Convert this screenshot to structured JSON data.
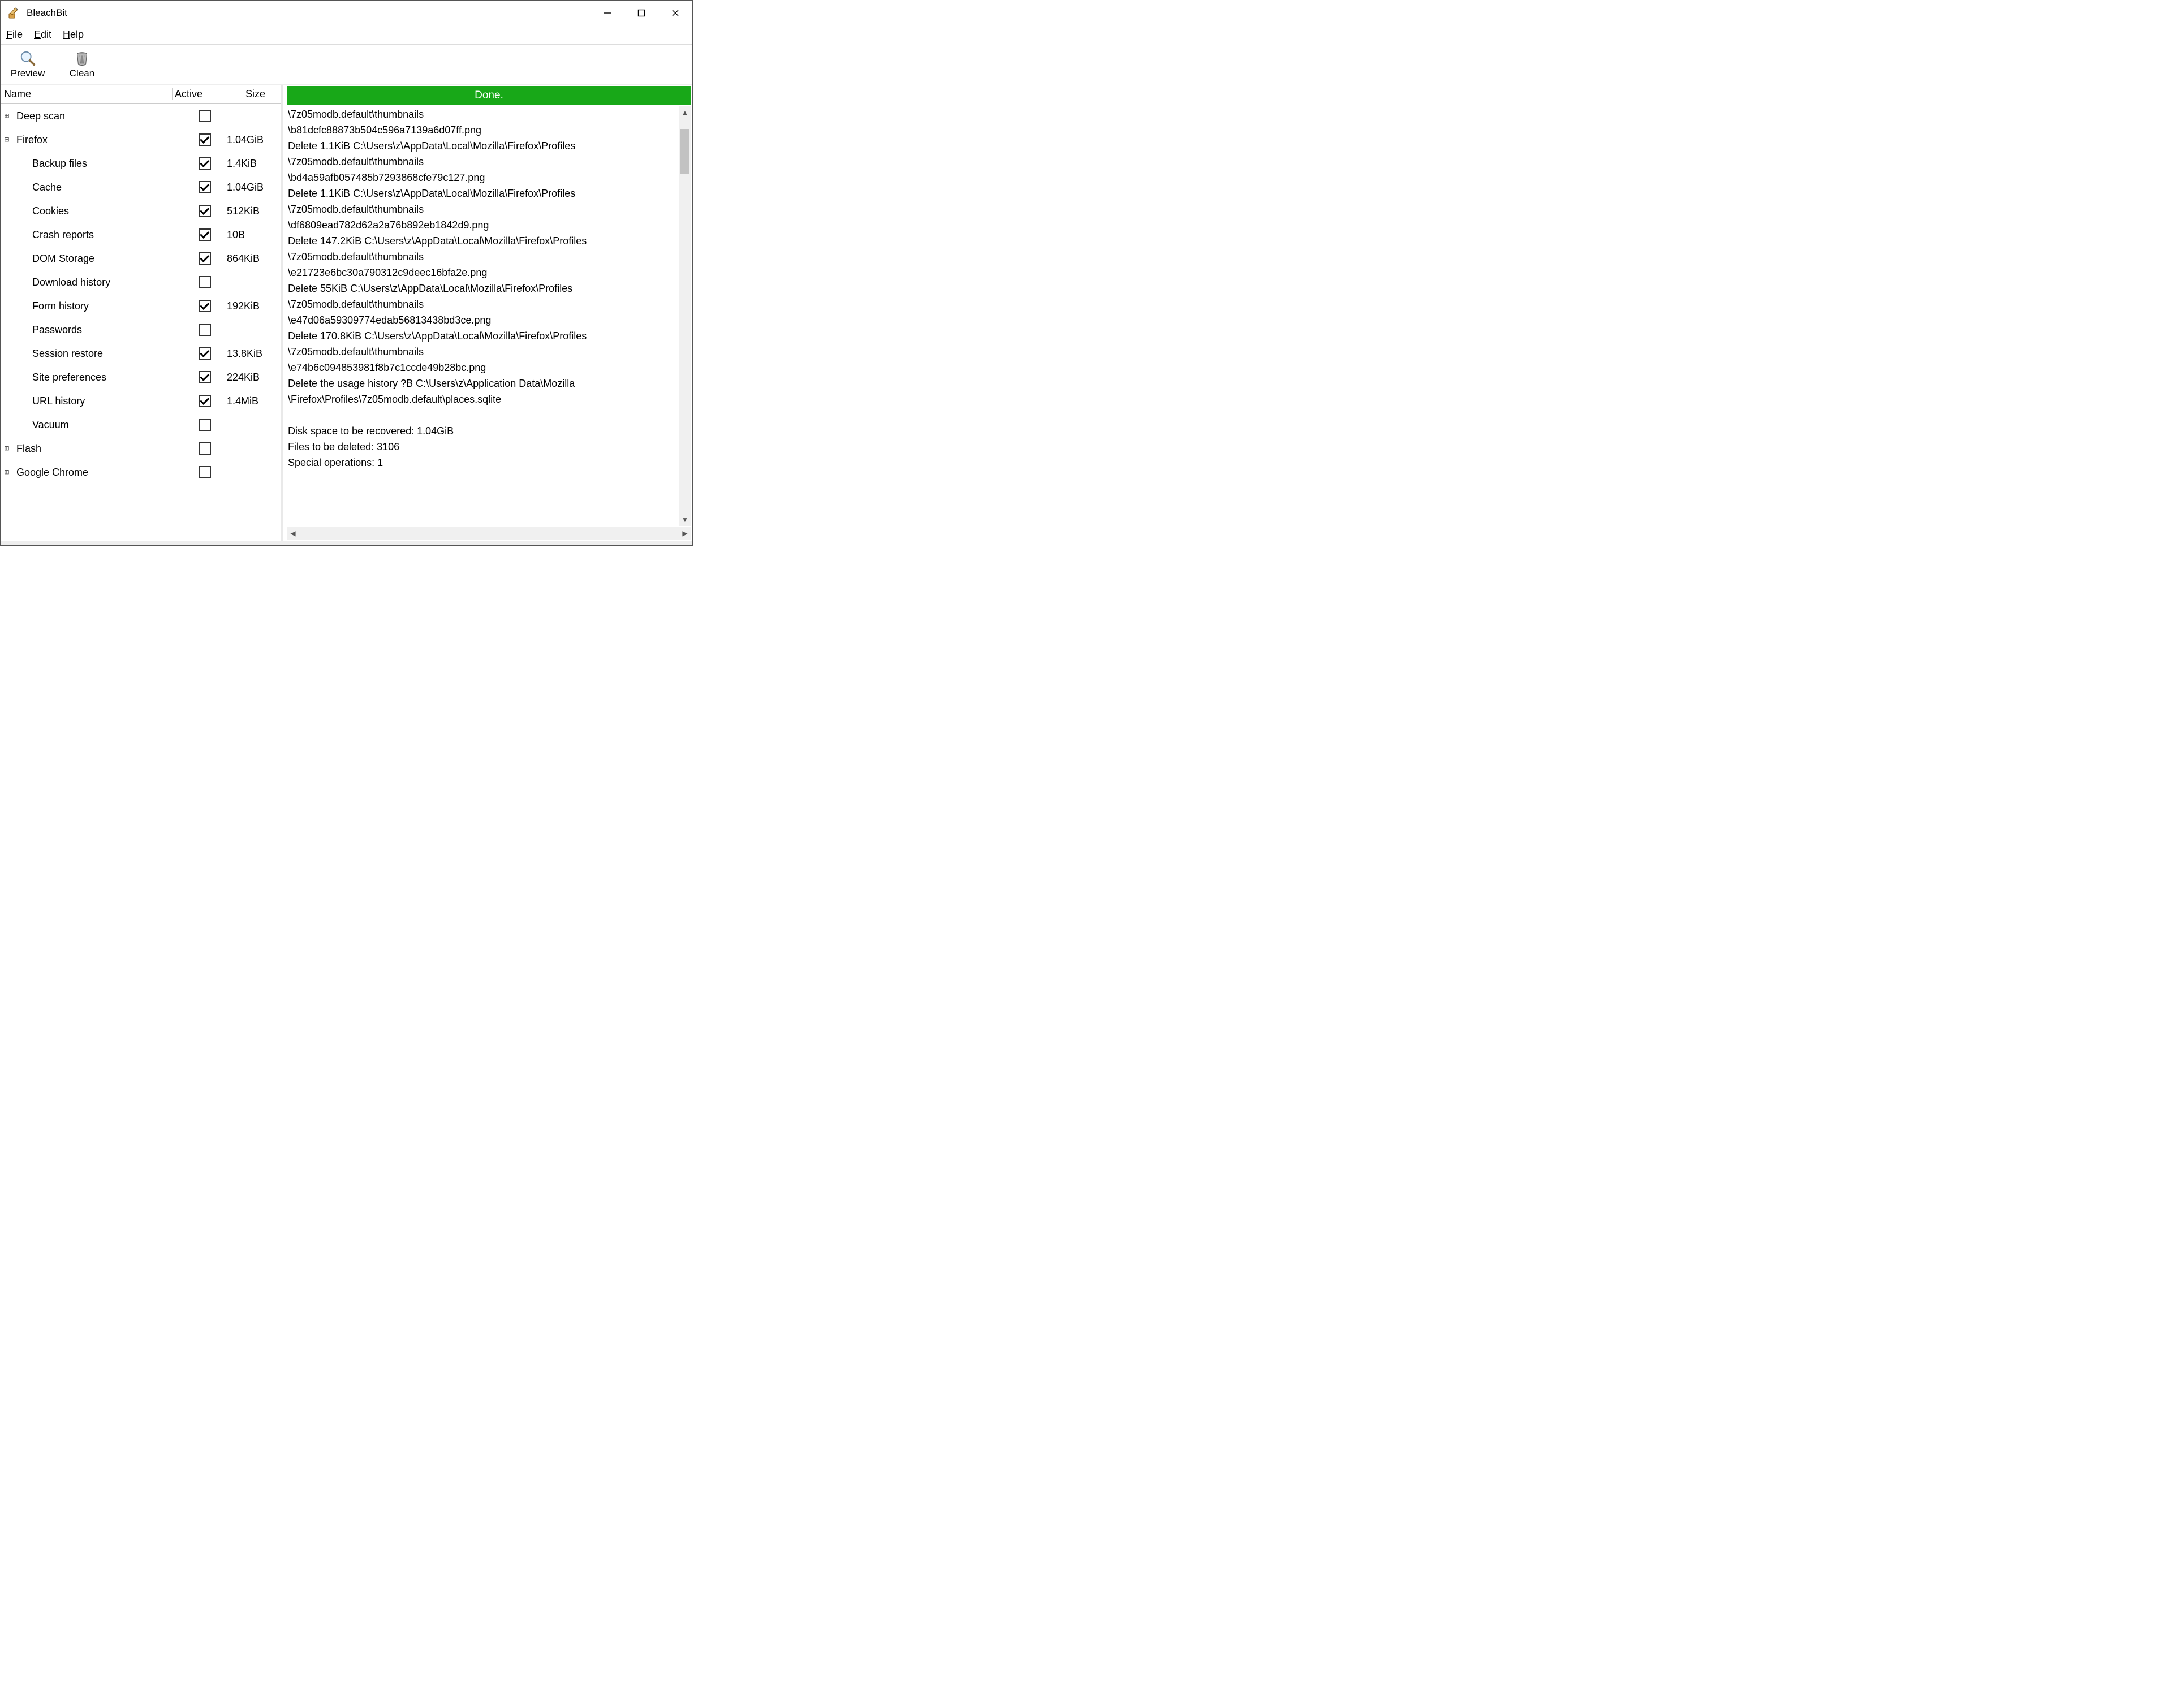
{
  "window": {
    "title": "BleachBit"
  },
  "menu": {
    "file": "File",
    "edit": "Edit",
    "help": "Help"
  },
  "toolbar": {
    "preview": "Preview",
    "clean": "Clean"
  },
  "tree": {
    "header": {
      "name": "Name",
      "active": "Active",
      "size": "Size"
    },
    "rows": [
      {
        "kind": "parent",
        "expander": "+",
        "label": "Deep scan",
        "checked": false,
        "size": ""
      },
      {
        "kind": "parent",
        "expander": "−",
        "label": "Firefox",
        "checked": true,
        "size": "1.04GiB"
      },
      {
        "kind": "child",
        "expander": "",
        "label": "Backup files",
        "checked": true,
        "size": "1.4KiB"
      },
      {
        "kind": "child",
        "expander": "",
        "label": "Cache",
        "checked": true,
        "size": "1.04GiB"
      },
      {
        "kind": "child",
        "expander": "",
        "label": "Cookies",
        "checked": true,
        "size": "512KiB"
      },
      {
        "kind": "child",
        "expander": "",
        "label": "Crash reports",
        "checked": true,
        "size": "10B"
      },
      {
        "kind": "child",
        "expander": "",
        "label": "DOM Storage",
        "checked": true,
        "size": "864KiB"
      },
      {
        "kind": "child",
        "expander": "",
        "label": "Download history",
        "checked": false,
        "size": ""
      },
      {
        "kind": "child",
        "expander": "",
        "label": "Form history",
        "checked": true,
        "size": "192KiB"
      },
      {
        "kind": "child",
        "expander": "",
        "label": "Passwords",
        "checked": false,
        "size": ""
      },
      {
        "kind": "child",
        "expander": "",
        "label": "Session restore",
        "checked": true,
        "size": "13.8KiB"
      },
      {
        "kind": "child",
        "expander": "",
        "label": "Site preferences",
        "checked": true,
        "size": "224KiB"
      },
      {
        "kind": "child",
        "expander": "",
        "label": "URL history",
        "checked": true,
        "size": "1.4MiB"
      },
      {
        "kind": "child",
        "expander": "",
        "label": "Vacuum",
        "checked": false,
        "size": ""
      },
      {
        "kind": "parent",
        "expander": "+",
        "label": "Flash",
        "checked": false,
        "size": ""
      },
      {
        "kind": "parent",
        "expander": "+",
        "label": "Google Chrome",
        "checked": false,
        "size": ""
      }
    ]
  },
  "status": {
    "text": "Done."
  },
  "log": {
    "lines": [
      "\\7z05modb.default\\thumbnails",
      "\\b81dcfc88873b504c596a7139a6d07ff.png",
      "Delete 1.1KiB C:\\Users\\z\\AppData\\Local\\Mozilla\\Firefox\\Profiles",
      "\\7z05modb.default\\thumbnails",
      "\\bd4a59afb057485b7293868cfe79c127.png",
      "Delete 1.1KiB C:\\Users\\z\\AppData\\Local\\Mozilla\\Firefox\\Profiles",
      "\\7z05modb.default\\thumbnails",
      "\\df6809ead782d62a2a76b892eb1842d9.png",
      "Delete 147.2KiB C:\\Users\\z\\AppData\\Local\\Mozilla\\Firefox\\Profiles",
      "\\7z05modb.default\\thumbnails",
      "\\e21723e6bc30a790312c9deec16bfa2e.png",
      "Delete 55KiB C:\\Users\\z\\AppData\\Local\\Mozilla\\Firefox\\Profiles",
      "\\7z05modb.default\\thumbnails",
      "\\e47d06a59309774edab56813438bd3ce.png",
      "Delete 170.8KiB C:\\Users\\z\\AppData\\Local\\Mozilla\\Firefox\\Profiles",
      "\\7z05modb.default\\thumbnails",
      "\\e74b6c094853981f8b7c1ccde49b28bc.png",
      "Delete the usage history ?B C:\\Users\\z\\Application Data\\Mozilla",
      "\\Firefox\\Profiles\\7z05modb.default\\places.sqlite",
      "",
      "Disk space to be recovered: 1.04GiB",
      "Files to be deleted: 3106",
      "Special operations: 1"
    ]
  }
}
